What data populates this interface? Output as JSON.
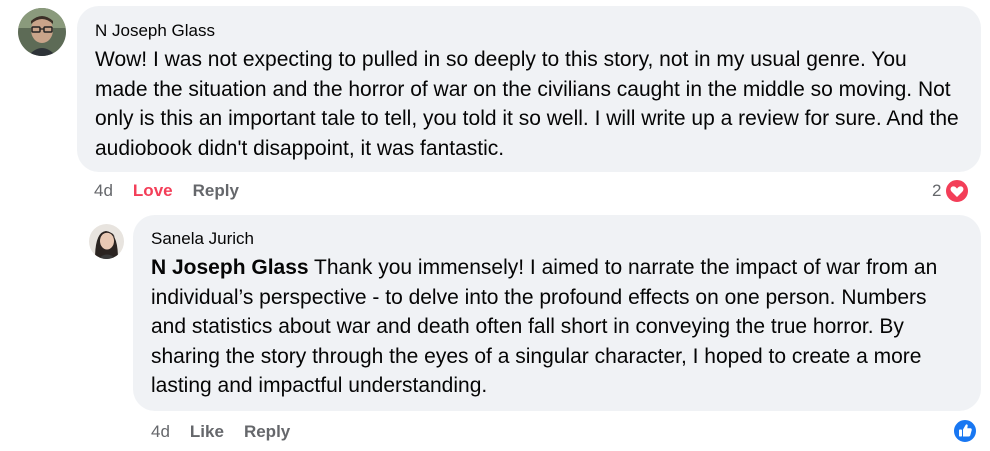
{
  "comments": [
    {
      "author": "N Joseph Glass",
      "text": "Wow! I was not expecting to pulled in so deeply to this story, not in my usual genre. You made the situation and the horror of war on the civilians caught in the middle so moving. Not only is this an important tale to tell, you told it so well. I will write up a review for sure. And the audiobook didn't disappoint, it was fantastic.",
      "time": "4d",
      "reaction_action": "Love",
      "reply_action": "Reply",
      "reaction_count": "2",
      "reaction_icon": "love-heart-icon",
      "reaction_color": "#f33e58"
    }
  ],
  "reply": {
    "author": "Sanela Jurich",
    "mention": "N Joseph Glass",
    "text": " Thank you immensely! I aimed to narrate the impact of war from an individual’s perspective - to delve into the profound effects on one person. Numbers and statistics about war and death often fall short in conveying the true horror. By sharing the story through the eyes of a singular character, I hoped to create a more lasting and impactful understanding.",
    "time": "4d",
    "reaction_action": "Like",
    "reply_action": "Reply",
    "reaction_icon": "like-thumb-icon",
    "reaction_color": "#1877f2"
  },
  "colors": {
    "bubble": "#f0f2f5",
    "muted": "#65676b",
    "love": "#f33e58",
    "like": "#1877f2"
  }
}
